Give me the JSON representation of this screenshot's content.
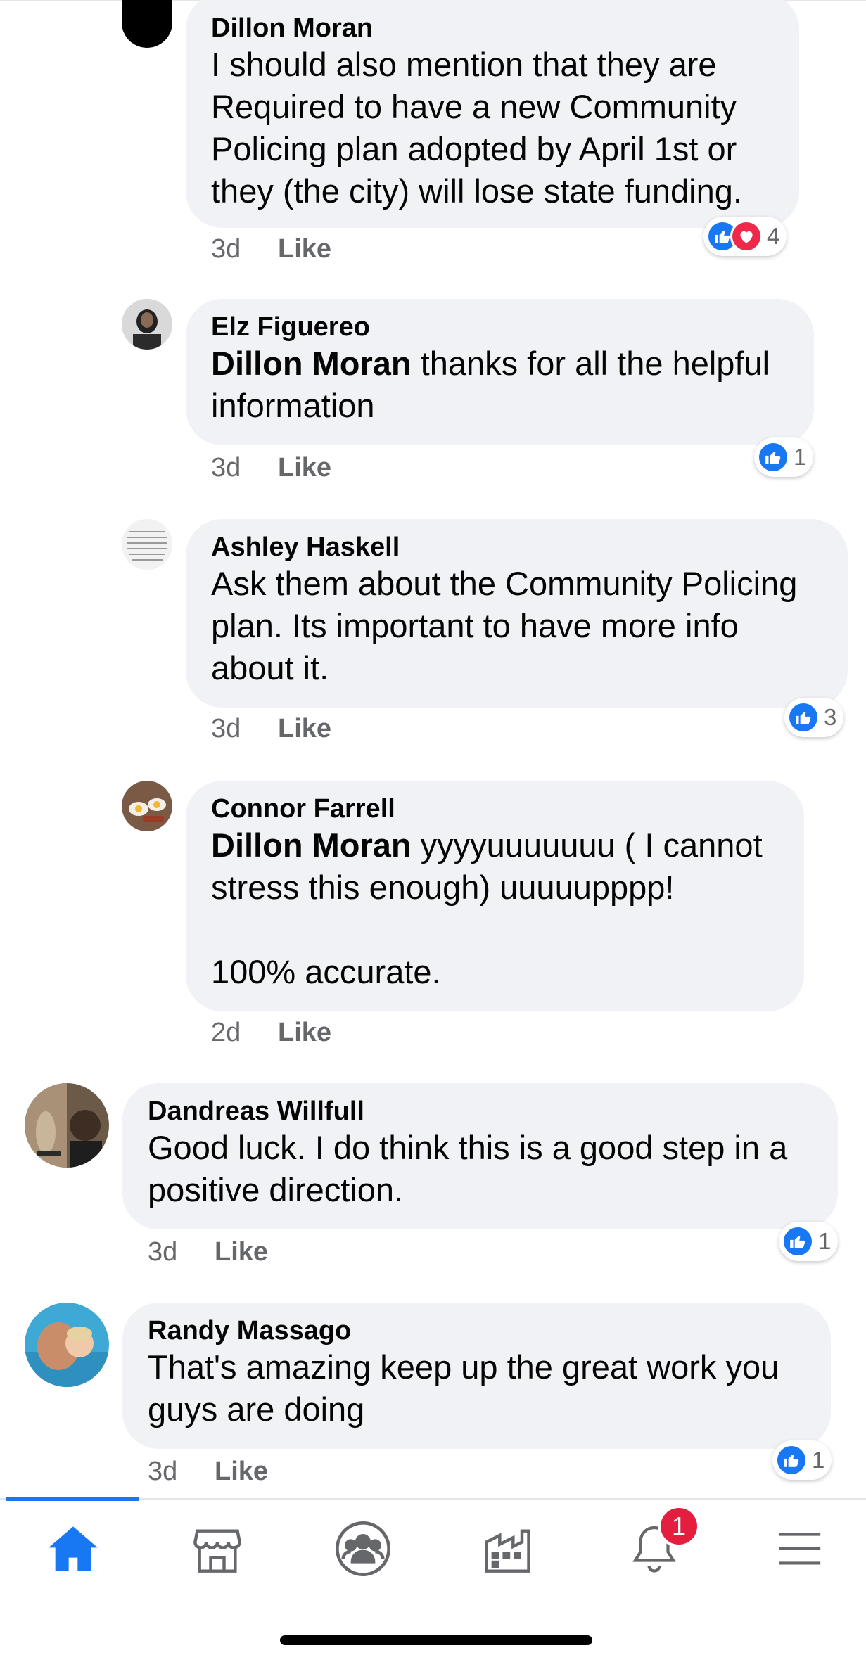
{
  "colors": {
    "accent": "#1877f2",
    "love": "#f02849",
    "badge": "#e41e3f",
    "bubble": "#f0f2f5",
    "meta": "#65676b"
  },
  "comments": [
    {
      "author": "Dillon Moran",
      "mention": "",
      "text": "I should also mention that they are\nRequired to have a new Community\nPolicing plan adopted by April 1st or\nthey (the city) will lose state funding.",
      "time": "3d",
      "like_label": "Like",
      "reaction_count": "4",
      "reactions": [
        "like-icon",
        "love-icon"
      ]
    },
    {
      "author": "Elz Figuereo",
      "mention": "Dillon Moran",
      "text": " thanks for all the helpful\ninformation",
      "time": "3d",
      "like_label": "Like",
      "reaction_count": "1",
      "reactions": [
        "like-icon"
      ]
    },
    {
      "author": "Ashley Haskell",
      "mention": "",
      "text": "Ask them about the Community Policing\nplan. Its important to have more info\nabout it.",
      "time": "3d",
      "like_label": "Like",
      "reaction_count": "3",
      "reactions": [
        "like-icon"
      ]
    },
    {
      "author": "Connor Farrell",
      "mention": "Dillon Moran",
      "text": " yyyyuuuuuuu ( I cannot\nstress this enough) uuuuupppp!\n\n100% accurate.",
      "time": "2d",
      "like_label": "Like",
      "reaction_count": "",
      "reactions": []
    },
    {
      "author": "Dandreas Willfull",
      "mention": "",
      "text": "Good luck. I do think this is a good step in a\npositive direction.",
      "time": "3d",
      "like_label": "Like",
      "reaction_count": "1",
      "reactions": [
        "like-icon"
      ]
    },
    {
      "author": "Randy Massago",
      "mention": "",
      "text": "That's amazing keep up the great work you\nguys are doing",
      "time": "3d",
      "like_label": "Like",
      "reaction_count": "1",
      "reactions": [
        "like-icon"
      ]
    }
  ],
  "nav": {
    "items": [
      "home-icon",
      "marketplace-icon",
      "groups-icon",
      "pages-icon",
      "notifications-icon",
      "menu-icon"
    ],
    "active": "home-icon",
    "notification_badge": "1"
  }
}
